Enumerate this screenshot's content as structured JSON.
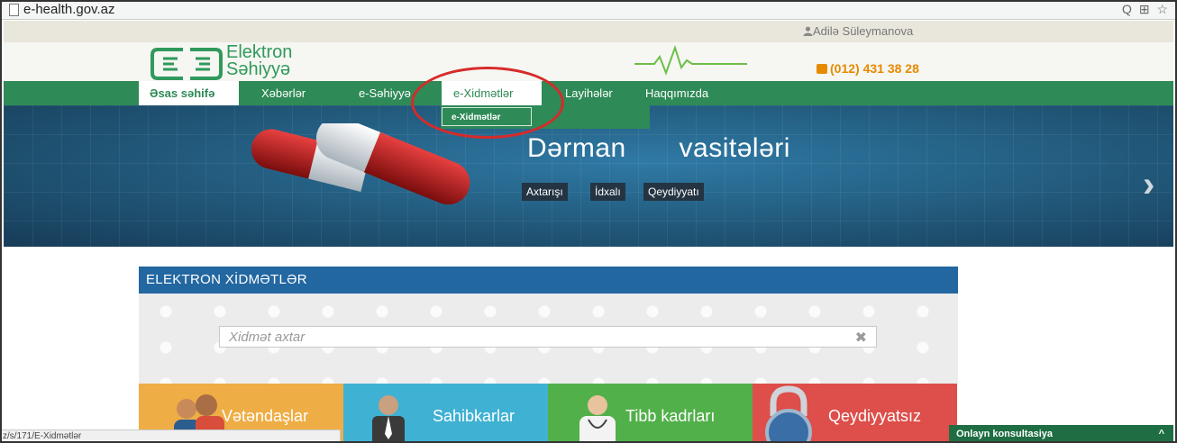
{
  "browser": {
    "url": "e-health.gov.az",
    "tools": "Q ⊞ ☆"
  },
  "userbar": {
    "user_name": "Adilə Süleymanova"
  },
  "header": {
    "logo_line1": "Elektron",
    "logo_line2": "Səhiyyə",
    "phone": "(012) 431 38 28"
  },
  "nav": {
    "items": [
      {
        "label": "Əsas səhifə"
      },
      {
        "label": "Xəbərlər"
      },
      {
        "label": "e-Səhiyyə"
      },
      {
        "label": "e-Xidmətlər"
      },
      {
        "label": "Layihələr"
      },
      {
        "label": "Haqqımızda"
      }
    ],
    "dropdown_item": "e-Xidmətlər"
  },
  "banner": {
    "title": "Dərman vasitələri",
    "buttons": [
      "Axtarışı",
      "İdxalı",
      "Qeydiyyatı"
    ]
  },
  "services": {
    "header": "ELEKTRON XİDMƏTLƏR",
    "search_placeholder": "Xidmət axtar",
    "tiles": [
      {
        "label": "Vətəndaşlar",
        "color": "#efad45"
      },
      {
        "label": "Sahibkarlar",
        "color": "#3fb1d3"
      },
      {
        "label": "Tibb kadrları",
        "color": "#52b04a"
      },
      {
        "label": "Qeydiyyatsız",
        "color": "#de4e4a"
      }
    ]
  },
  "status_bar": {
    "text": "z/s/171/E-Xidmətlər"
  },
  "chat": {
    "label": "Onlayn konsultasiya",
    "caret": "^"
  },
  "colors": {
    "brand_green": "#2e8a56",
    "banner_blue": "#24506e",
    "services_blue": "#2367a1",
    "phone_orange": "#e68a00",
    "highlight_red": "#d62b2b"
  }
}
